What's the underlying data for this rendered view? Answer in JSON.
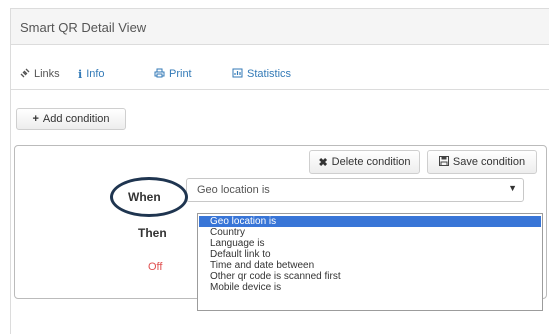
{
  "panel": {
    "title": "Smart QR Detail View"
  },
  "tabs": [
    {
      "label": "Links",
      "icon": "link-icon",
      "active": true
    },
    {
      "label": "Info",
      "icon": "info-icon",
      "active": false
    },
    {
      "label": "Print",
      "icon": "print-icon",
      "active": false
    },
    {
      "label": "Statistics",
      "icon": "chart-icon",
      "active": false
    }
  ],
  "toolbar": {
    "add_condition": "Add condition"
  },
  "condition": {
    "delete_label": "Delete condition",
    "save_label": "Save condition",
    "when_label": "When",
    "then_label": "Then",
    "off_label": "Off",
    "off_color": "#e05050",
    "select_value": "Geo location is",
    "options": [
      "Geo location is",
      "Country",
      "Language is",
      "Default link to",
      "Time and date between",
      "Other qr code is scanned first",
      "Mobile device is"
    ],
    "selected_index": 0
  },
  "colors": {
    "accent": "#337ab7",
    "highlight": "#3875d7",
    "annotation_circle": "#1f3550"
  }
}
